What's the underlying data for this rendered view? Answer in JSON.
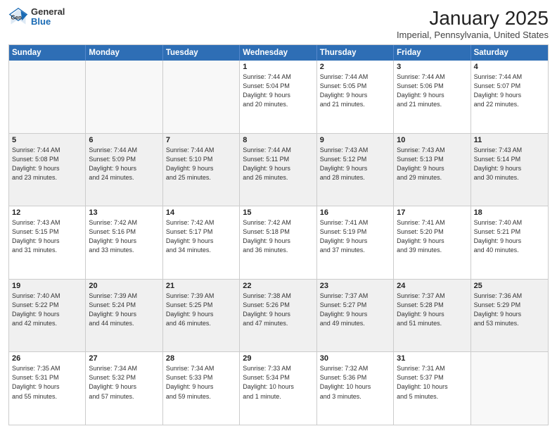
{
  "header": {
    "logo_general": "General",
    "logo_blue": "Blue",
    "title": "January 2025",
    "location": "Imperial, Pennsylvania, United States"
  },
  "days_of_week": [
    "Sunday",
    "Monday",
    "Tuesday",
    "Wednesday",
    "Thursday",
    "Friday",
    "Saturday"
  ],
  "weeks": [
    [
      {
        "day": "",
        "info": "",
        "empty": true
      },
      {
        "day": "",
        "info": "",
        "empty": true
      },
      {
        "day": "",
        "info": "",
        "empty": true
      },
      {
        "day": "1",
        "info": "Sunrise: 7:44 AM\nSunset: 5:04 PM\nDaylight: 9 hours\nand 20 minutes."
      },
      {
        "day": "2",
        "info": "Sunrise: 7:44 AM\nSunset: 5:05 PM\nDaylight: 9 hours\nand 21 minutes."
      },
      {
        "day": "3",
        "info": "Sunrise: 7:44 AM\nSunset: 5:06 PM\nDaylight: 9 hours\nand 21 minutes."
      },
      {
        "day": "4",
        "info": "Sunrise: 7:44 AM\nSunset: 5:07 PM\nDaylight: 9 hours\nand 22 minutes."
      }
    ],
    [
      {
        "day": "5",
        "info": "Sunrise: 7:44 AM\nSunset: 5:08 PM\nDaylight: 9 hours\nand 23 minutes."
      },
      {
        "day": "6",
        "info": "Sunrise: 7:44 AM\nSunset: 5:09 PM\nDaylight: 9 hours\nand 24 minutes."
      },
      {
        "day": "7",
        "info": "Sunrise: 7:44 AM\nSunset: 5:10 PM\nDaylight: 9 hours\nand 25 minutes."
      },
      {
        "day": "8",
        "info": "Sunrise: 7:44 AM\nSunset: 5:11 PM\nDaylight: 9 hours\nand 26 minutes."
      },
      {
        "day": "9",
        "info": "Sunrise: 7:43 AM\nSunset: 5:12 PM\nDaylight: 9 hours\nand 28 minutes."
      },
      {
        "day": "10",
        "info": "Sunrise: 7:43 AM\nSunset: 5:13 PM\nDaylight: 9 hours\nand 29 minutes."
      },
      {
        "day": "11",
        "info": "Sunrise: 7:43 AM\nSunset: 5:14 PM\nDaylight: 9 hours\nand 30 minutes."
      }
    ],
    [
      {
        "day": "12",
        "info": "Sunrise: 7:43 AM\nSunset: 5:15 PM\nDaylight: 9 hours\nand 31 minutes."
      },
      {
        "day": "13",
        "info": "Sunrise: 7:42 AM\nSunset: 5:16 PM\nDaylight: 9 hours\nand 33 minutes."
      },
      {
        "day": "14",
        "info": "Sunrise: 7:42 AM\nSunset: 5:17 PM\nDaylight: 9 hours\nand 34 minutes."
      },
      {
        "day": "15",
        "info": "Sunrise: 7:42 AM\nSunset: 5:18 PM\nDaylight: 9 hours\nand 36 minutes."
      },
      {
        "day": "16",
        "info": "Sunrise: 7:41 AM\nSunset: 5:19 PM\nDaylight: 9 hours\nand 37 minutes."
      },
      {
        "day": "17",
        "info": "Sunrise: 7:41 AM\nSunset: 5:20 PM\nDaylight: 9 hours\nand 39 minutes."
      },
      {
        "day": "18",
        "info": "Sunrise: 7:40 AM\nSunset: 5:21 PM\nDaylight: 9 hours\nand 40 minutes."
      }
    ],
    [
      {
        "day": "19",
        "info": "Sunrise: 7:40 AM\nSunset: 5:22 PM\nDaylight: 9 hours\nand 42 minutes."
      },
      {
        "day": "20",
        "info": "Sunrise: 7:39 AM\nSunset: 5:24 PM\nDaylight: 9 hours\nand 44 minutes."
      },
      {
        "day": "21",
        "info": "Sunrise: 7:39 AM\nSunset: 5:25 PM\nDaylight: 9 hours\nand 46 minutes."
      },
      {
        "day": "22",
        "info": "Sunrise: 7:38 AM\nSunset: 5:26 PM\nDaylight: 9 hours\nand 47 minutes."
      },
      {
        "day": "23",
        "info": "Sunrise: 7:37 AM\nSunset: 5:27 PM\nDaylight: 9 hours\nand 49 minutes."
      },
      {
        "day": "24",
        "info": "Sunrise: 7:37 AM\nSunset: 5:28 PM\nDaylight: 9 hours\nand 51 minutes."
      },
      {
        "day": "25",
        "info": "Sunrise: 7:36 AM\nSunset: 5:29 PM\nDaylight: 9 hours\nand 53 minutes."
      }
    ],
    [
      {
        "day": "26",
        "info": "Sunrise: 7:35 AM\nSunset: 5:31 PM\nDaylight: 9 hours\nand 55 minutes."
      },
      {
        "day": "27",
        "info": "Sunrise: 7:34 AM\nSunset: 5:32 PM\nDaylight: 9 hours\nand 57 minutes."
      },
      {
        "day": "28",
        "info": "Sunrise: 7:34 AM\nSunset: 5:33 PM\nDaylight: 9 hours\nand 59 minutes."
      },
      {
        "day": "29",
        "info": "Sunrise: 7:33 AM\nSunset: 5:34 PM\nDaylight: 10 hours\nand 1 minute."
      },
      {
        "day": "30",
        "info": "Sunrise: 7:32 AM\nSunset: 5:36 PM\nDaylight: 10 hours\nand 3 minutes."
      },
      {
        "day": "31",
        "info": "Sunrise: 7:31 AM\nSunset: 5:37 PM\nDaylight: 10 hours\nand 5 minutes."
      },
      {
        "day": "",
        "info": "",
        "empty": true
      }
    ]
  ]
}
